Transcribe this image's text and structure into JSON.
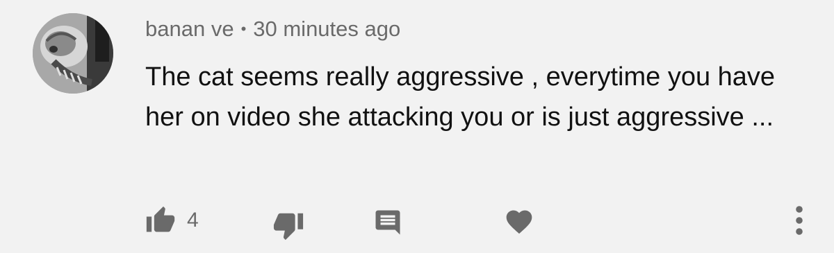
{
  "comment": {
    "author": "banan ve",
    "separator": "•",
    "timestamp": "30 minutes ago",
    "text": "The cat seems really aggressive , everytime you have her on video she attacking you or is just aggressive ...",
    "like_count": "4"
  },
  "icons": {
    "like": "thumbs-up-icon",
    "dislike": "thumbs-down-icon",
    "reply": "comment-icon",
    "heart": "heart-icon",
    "more": "more-vertical-icon"
  },
  "colors": {
    "background": "#f2f2f2",
    "text": "#111111",
    "muted": "#6a6a6a"
  }
}
